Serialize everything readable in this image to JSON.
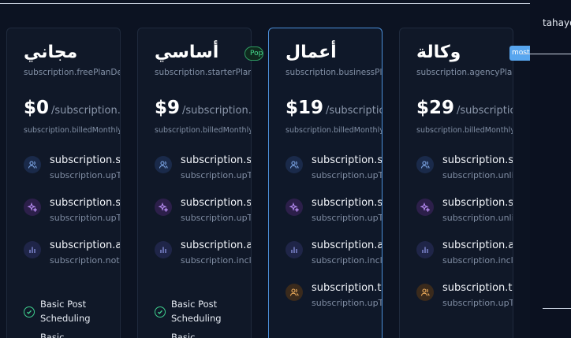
{
  "side_panel": {
    "user": "tahayo"
  },
  "plans": [
    {
      "name": "مجاني",
      "description": "subscription.freePlanDescription",
      "price": "$0",
      "period": "/subscription.monthly",
      "billed": "subscription.billedMonthly",
      "features": [
        {
          "icon": "users-icon",
          "title": "subscription.socialAccounts",
          "subtitle": "subscription.upTo"
        },
        {
          "icon": "sparkles-icon",
          "title": "subscription.scheduledPosts",
          "subtitle": "subscription.upTo"
        },
        {
          "icon": "bar-chart-icon",
          "title": "subscription.advancedAnalytics",
          "subtitle": "subscription.notIncluded"
        }
      ],
      "checklist": [
        "Basic Post Scheduling",
        "Basic"
      ]
    },
    {
      "name": "أساسي",
      "description": "subscription.starterPlanDescription",
      "price": "$9",
      "period": "/subscription.monthly",
      "billed": "subscription.billedMonthly",
      "badge": "Popular",
      "features": [
        {
          "icon": "users-icon",
          "title": "subscription.socialAccounts",
          "subtitle": "subscription.upTo"
        },
        {
          "icon": "sparkles-icon",
          "title": "subscription.scheduledPosts",
          "subtitle": "subscription.upTo"
        },
        {
          "icon": "bar-chart-icon",
          "title": "subscription.advancedAnalytics",
          "subtitle": "subscription.included"
        }
      ],
      "checklist": [
        "Basic Post Scheduling",
        "Basic"
      ]
    },
    {
      "name": "أعمال",
      "description": "subscription.businessPlanDescription",
      "price": "$19",
      "period": "/subscription.monthly",
      "billed": "subscription.billedMonthly",
      "features": [
        {
          "icon": "users-icon",
          "title": "subscription.socialAccounts",
          "subtitle": "subscription.upTo"
        },
        {
          "icon": "sparkles-icon",
          "title": "subscription.scheduledPosts",
          "subtitle": "subscription.upTo"
        },
        {
          "icon": "bar-chart-icon",
          "title": "subscription.advancedAnalytics",
          "subtitle": "subscription.included"
        },
        {
          "icon": "team-icon",
          "title": "subscription.teamMembers",
          "subtitle": "subscription.upTo"
        }
      ]
    },
    {
      "name": "وكالة",
      "description": "subscription.agencyPlanDescription",
      "price": "$29",
      "period": "/subscription.monthly",
      "billed": "subscription.billedMonthly",
      "badge": "mostPopular",
      "features": [
        {
          "icon": "users-icon",
          "title": "subscription.socialAccounts",
          "subtitle": "subscription.unlimited"
        },
        {
          "icon": "sparkles-icon",
          "title": "subscription.scheduledPosts",
          "subtitle": "subscription.unlimited"
        },
        {
          "icon": "bar-chart-icon",
          "title": "subscription.advancedAnalytics",
          "subtitle": "subscription.included"
        },
        {
          "icon": "team-icon",
          "title": "subscription.teamMembers",
          "subtitle": "subscription.upTo"
        }
      ]
    }
  ]
}
